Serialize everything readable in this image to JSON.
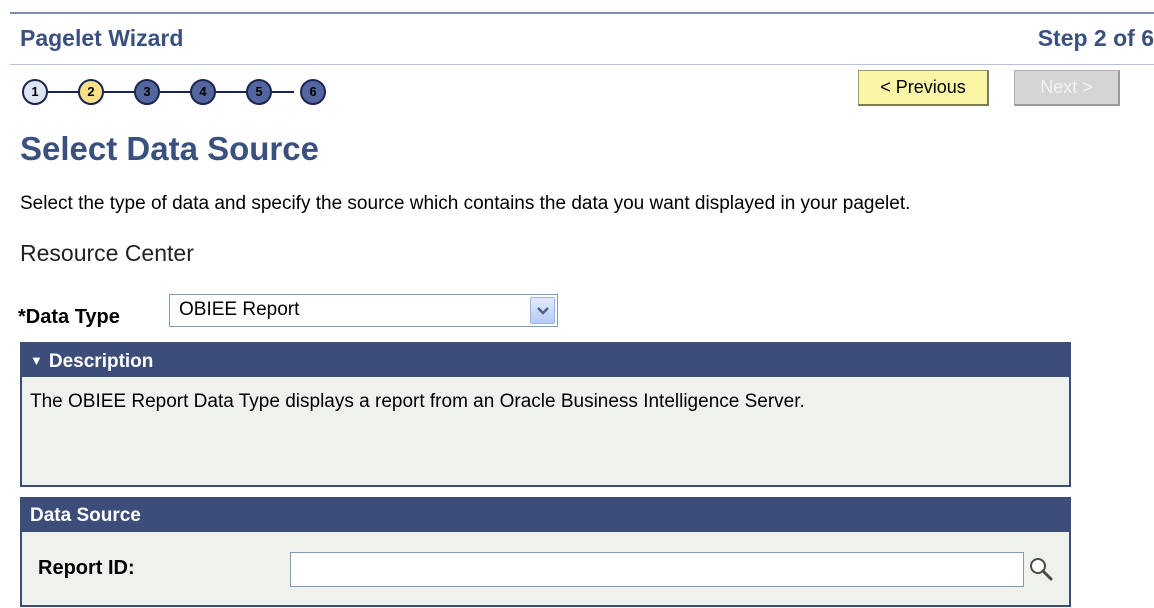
{
  "wizard": {
    "title": "Pagelet Wizard",
    "step_text": "Step 2 of 6",
    "steps": [
      "1",
      "2",
      "3",
      "4",
      "5",
      "6"
    ],
    "current_step": 2,
    "previous_label": "< Previous",
    "next_label": "Next >"
  },
  "page": {
    "title": "Select Data Source",
    "instructions": "Select the type of data and specify the source which contains the data you want displayed in your pagelet.",
    "resource_link": "Resource Center"
  },
  "data_type": {
    "label": "*Data Type",
    "value": "OBIEE Report"
  },
  "description": {
    "header": "Description",
    "text": "The OBIEE Report Data Type displays a report from an Oracle Business Intelligence Server."
  },
  "data_source": {
    "header": "Data Source",
    "report_id_label": "Report ID:",
    "report_id_value": ""
  },
  "colors": {
    "header_blue": "#3a5180",
    "panel_header": "#3d4d7a",
    "panel_body": "#eef1ec",
    "current_step": "#f7e08a",
    "previous_button": "#fbf6a5"
  },
  "icons": {
    "lookup": "magnifying-glass-icon",
    "collapse": "triangle-down-icon",
    "dropdown": "chevron-down-icon"
  }
}
